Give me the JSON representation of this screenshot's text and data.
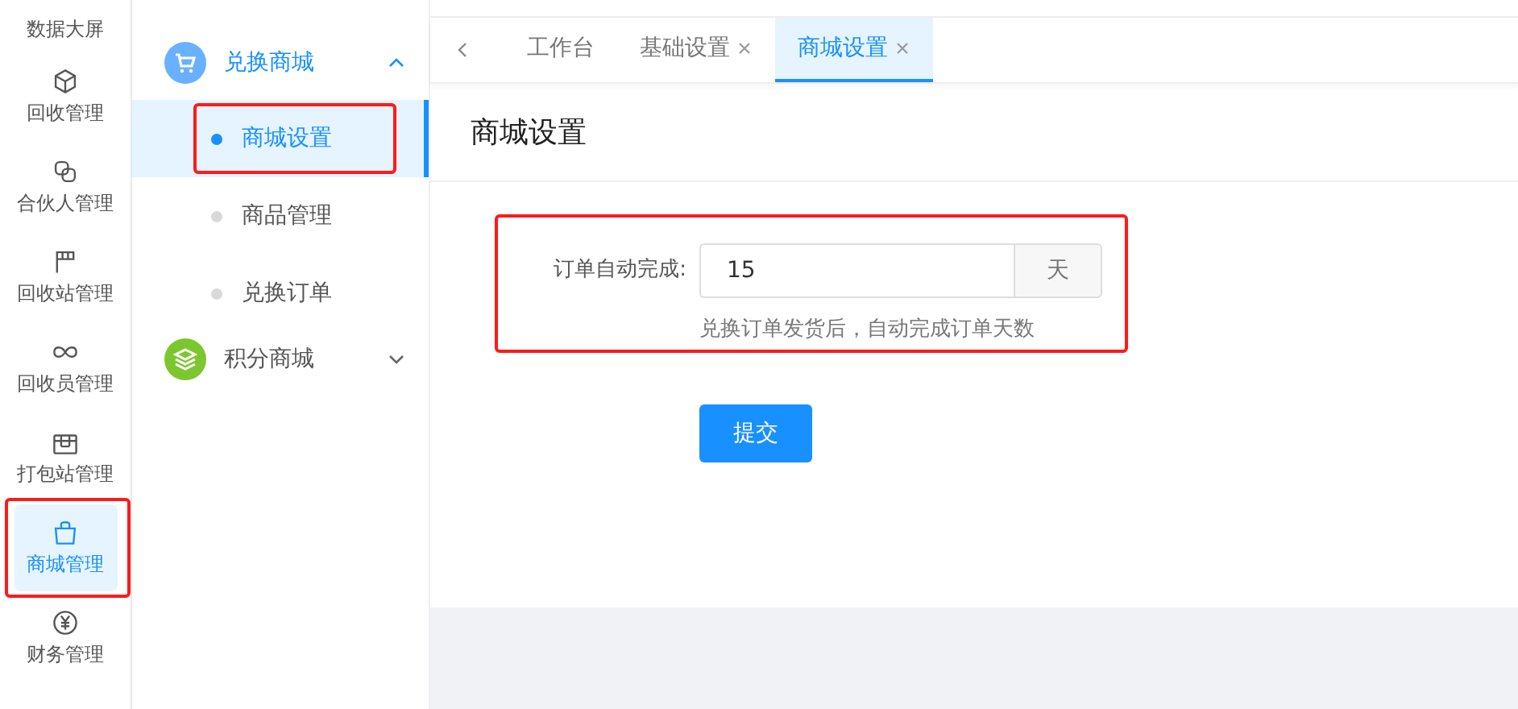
{
  "rail": {
    "header": "数据大屏",
    "items": [
      {
        "label": "回收管理",
        "selected": false,
        "annotated": false
      },
      {
        "label": "合伙人管理",
        "selected": false,
        "annotated": false
      },
      {
        "label": "回收站管理",
        "selected": false,
        "annotated": false
      },
      {
        "label": "回收员管理",
        "selected": false,
        "annotated": false
      },
      {
        "label": "打包站管理",
        "selected": false,
        "annotated": false
      },
      {
        "label": "商城管理",
        "selected": true,
        "annotated": true
      },
      {
        "label": "财务管理",
        "selected": false,
        "annotated": false
      }
    ]
  },
  "menu": {
    "groups": [
      {
        "label": "兑换商城",
        "color": "#69b1ff",
        "expanded": true,
        "children": [
          {
            "label": "商城设置",
            "selected": true,
            "annotated": true
          },
          {
            "label": "商品管理",
            "selected": false,
            "annotated": false
          },
          {
            "label": "兑换订单",
            "selected": false,
            "annotated": false
          }
        ]
      },
      {
        "label": "积分商城",
        "color": "#7cc72e",
        "expanded": false
      }
    ]
  },
  "tabs": [
    {
      "label": "工作台",
      "closable": false,
      "selected": false
    },
    {
      "label": "基础设置",
      "closable": true,
      "selected": false
    },
    {
      "label": "商城设置",
      "closable": true,
      "selected": true
    }
  ],
  "page_title": "商城设置",
  "form": {
    "annotated": true,
    "label": "订单自动完成:",
    "value": "15",
    "suffix": "天",
    "hint": "兑换订单发货后，自动完成订单天数",
    "submit": "提交"
  }
}
